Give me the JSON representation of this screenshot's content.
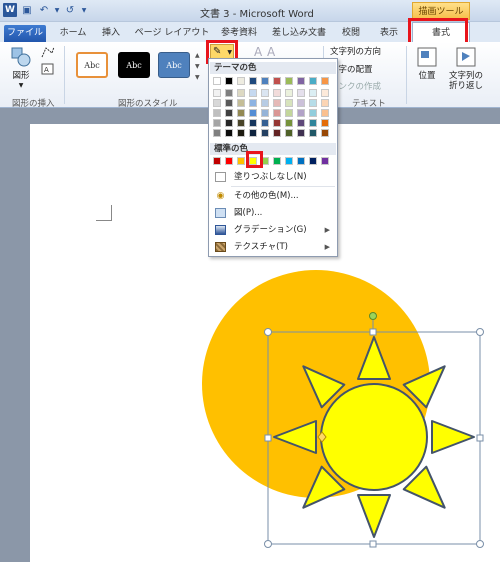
{
  "window": {
    "title": "文書 3 - Microsoft Word",
    "context_tool_label": "描画ツール"
  },
  "tabs": [
    {
      "label": "ファイル"
    },
    {
      "label": "ホーム"
    },
    {
      "label": "挿入"
    },
    {
      "label": "ページ レイアウト"
    },
    {
      "label": "参考資料"
    },
    {
      "label": "差し込み文書"
    },
    {
      "label": "校閲"
    },
    {
      "label": "表示"
    },
    {
      "label": "書式"
    }
  ],
  "ribbon": {
    "insert_shapes": {
      "shape_button": "図形",
      "group_label": "図形の挿入"
    },
    "shape_styles": {
      "style_sample": "Abc",
      "group_label": "図形のスタイル"
    },
    "text": {
      "text_direction": "文字列の方向",
      "text_align": "文字の配置",
      "create_link": "リンクの作成",
      "group_label": "テキスト"
    },
    "arrange": {
      "position": "位置",
      "wrap_text_line1": "文字列の",
      "wrap_text_line2": "折り返し"
    },
    "colors": {
      "style_outline": "#e8913a",
      "style_black": "#000000",
      "style_blue": "#4f81bd"
    }
  },
  "fill_menu": {
    "theme_colors_header": "テーマの色",
    "standard_colors_header": "標準の色",
    "no_fill": "塗りつぶしなし(N)",
    "more_colors": "その他の色(M)...",
    "picture": "図(P)...",
    "gradient": "グラデーション(G)",
    "texture": "テクスチャ(T)",
    "theme_top_row": [
      "#ffffff",
      "#000000",
      "#eeece1",
      "#1f497d",
      "#4f81bd",
      "#c0504d",
      "#9bbb59",
      "#8064a2",
      "#4bacc6",
      "#f79646"
    ],
    "theme_shades": [
      [
        "#f2f2f2",
        "#7f7f7f",
        "#ddd9c3",
        "#c6d9f0",
        "#dbe5f1",
        "#f2dcdb",
        "#ebf1dd",
        "#e5e0ec",
        "#dbeef3",
        "#fdeada"
      ],
      [
        "#d8d8d8",
        "#595959",
        "#c4bd97",
        "#8db3e2",
        "#b8cce4",
        "#e5b9b7",
        "#d7e3bc",
        "#ccc1d9",
        "#b7dde8",
        "#fbd5b5"
      ],
      [
        "#bfbfbf",
        "#3f3f3f",
        "#938953",
        "#548dd4",
        "#95b3d7",
        "#d99694",
        "#c3d69b",
        "#b2a2c7",
        "#92cddc",
        "#fac08f"
      ],
      [
        "#a5a5a5",
        "#262626",
        "#494429",
        "#17365d",
        "#366092",
        "#953734",
        "#76923c",
        "#5f497a",
        "#31859b",
        "#e36c09"
      ],
      [
        "#7f7f7f",
        "#0c0c0c",
        "#1d1b10",
        "#0f243e",
        "#244061",
        "#632423",
        "#4f6128",
        "#3f3151",
        "#205867",
        "#974806"
      ]
    ],
    "standard_colors": [
      "#c00000",
      "#ff0000",
      "#ffc000",
      "#ffff00",
      "#92d050",
      "#00b050",
      "#00b0f0",
      "#0070c0",
      "#002060",
      "#7030a0"
    ],
    "selected_standard_color": "#ffff00"
  },
  "canvas": {
    "orange_circle_color": "#ffc000",
    "sun_fill_color": "#ffff00",
    "sun_outline_color": "#44546a"
  }
}
